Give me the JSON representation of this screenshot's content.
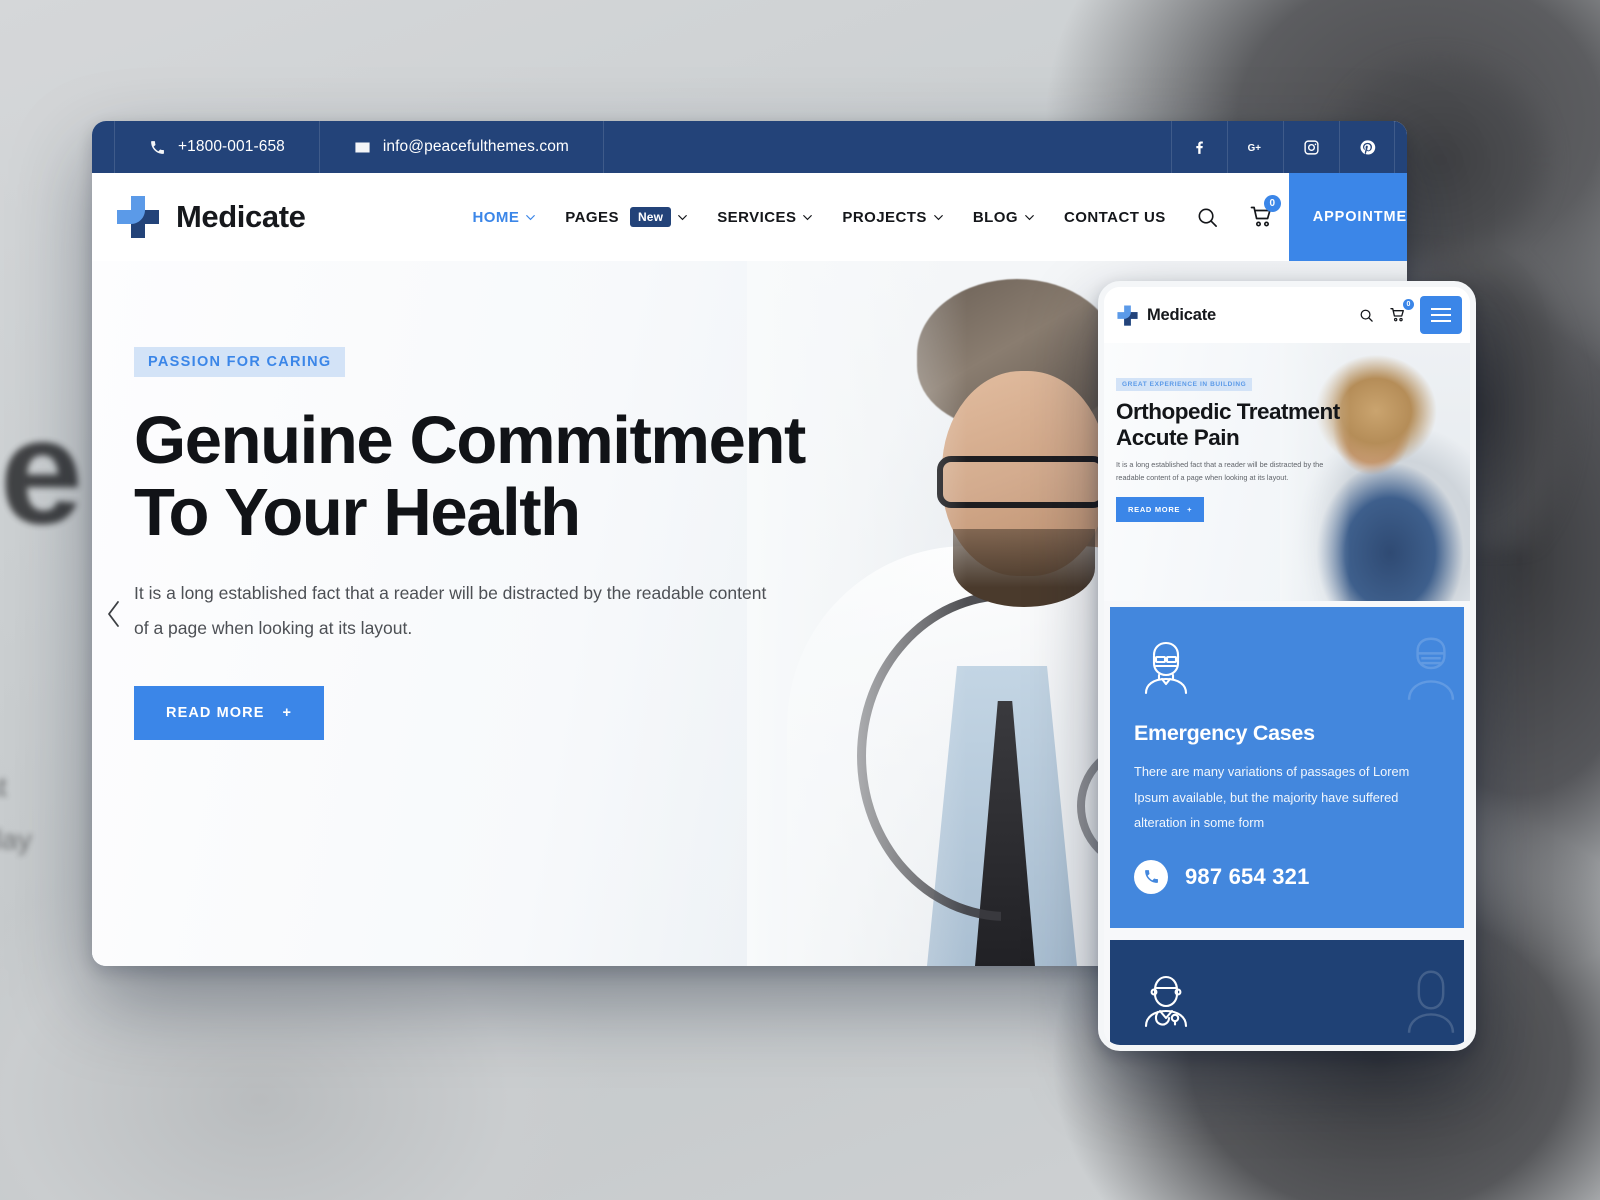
{
  "topbar": {
    "phone": "+1800-001-658",
    "email": "info@peacefulthemes.com",
    "phone_icon": "phone-icon",
    "email_icon": "envelope-icon",
    "social": [
      {
        "name": "facebook-icon",
        "label": "f"
      },
      {
        "name": "google-plus-icon",
        "label": "G+"
      },
      {
        "name": "instagram-icon",
        "label": ""
      },
      {
        "name": "pinterest-icon",
        "label": ""
      }
    ]
  },
  "navbar": {
    "brand": "Medicate",
    "links": [
      {
        "label": "HOME",
        "active": true,
        "caret": true,
        "badge": ""
      },
      {
        "label": "PAGES",
        "active": false,
        "caret": true,
        "badge": "New"
      },
      {
        "label": "SERVICES",
        "active": false,
        "caret": true,
        "badge": ""
      },
      {
        "label": "PROJECTS",
        "active": false,
        "caret": true,
        "badge": ""
      },
      {
        "label": "BLOG",
        "active": false,
        "caret": true,
        "badge": ""
      },
      {
        "label": "CONTACT US",
        "active": false,
        "caret": false,
        "badge": ""
      }
    ],
    "cart_count": "0",
    "appointments_label": "APPOINTMENTS",
    "appointments_plus": "+",
    "accent_color": "#3b86e8",
    "topbar_color": "#234379"
  },
  "hero": {
    "eyebrow": "PASSION FOR CARING",
    "title": "Genuine Commitment\nTo Your Health",
    "paragraph": "It is a long established fact that a reader will be distracted by the readable content\nof a page when looking at its layout.",
    "cta_label": "READ MORE",
    "cta_plus": "+",
    "prev_arrow": "chevron-left-icon"
  },
  "phone_mockup": {
    "brand": "Medicate",
    "cart_count": "0",
    "hero": {
      "eyebrow": "GREAT EXPERIENCE IN BUILDING",
      "title": "Orthopedic Treatment\nAccute Pain",
      "paragraph": "It is a long established fact that a reader will be distracted by the\nreadable content of a page when looking at its layout.",
      "cta_label": "READ MORE",
      "cta_plus": "+"
    },
    "cards": [
      {
        "icon": "doctor-mask-icon",
        "title": "Emergency Cases",
        "text": "There are many variations of passages of Lorem\nIpsum available, but the majority have suffered\nalteration in some form",
        "phone_icon": "phone-icon",
        "phone": "987 654 321",
        "bg": "#4387dd"
      },
      {
        "icon": "doctor-stethoscope-icon",
        "title": "",
        "text": "",
        "phone_icon": "",
        "phone": "",
        "bg": "#1f4175"
      }
    ]
  },
  "backdrop": {
    "blurred_title": "ne\nr",
    "blurred_sub": "that\nits lay"
  }
}
